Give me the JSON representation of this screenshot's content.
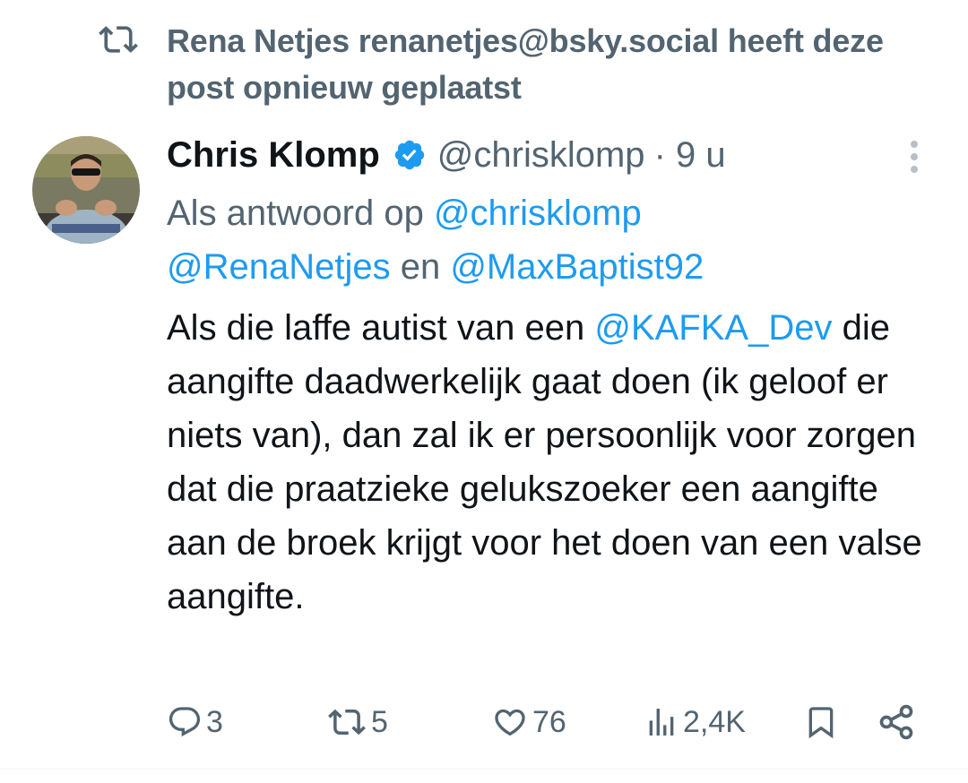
{
  "repost": {
    "icon": "repost-icon",
    "text": "Rena Netjes renanetjes@bsky.social heeft deze post opnieuw geplaatst"
  },
  "post": {
    "author": {
      "name": "Chris Klomp",
      "verified_icon": "verified-badge-icon",
      "handle": "@chrisklomp",
      "time": "· 9 u",
      "avatar_icon": "avatar"
    },
    "more_icon": "more-icon",
    "reply_to": {
      "prefix": "Als antwoord op ",
      "mention1": "@chrisklomp",
      "mention2": "@RenaNetjes",
      "connector": " en ",
      "mention3": "@MaxBaptist92"
    },
    "body": {
      "start": "Als die laffe autist van een ",
      "mention": "@KAFKA_Dev",
      "rest": " die aangifte daadwerkelijk gaat doen (ik geloof er niets van), dan zal ik er persoonlijk voor zorgen dat die praatzieke gelukszoeker een aangifte aan de broek krijgt voor het doen van een valse aangifte."
    },
    "actions": {
      "replies": "3",
      "reposts": "5",
      "likes": "76",
      "views": "2,4K"
    }
  },
  "colors": {
    "text_primary": "#0f1419",
    "text_secondary": "#536471",
    "accent": "#1d9bf0",
    "divider": "#eff3f4"
  }
}
